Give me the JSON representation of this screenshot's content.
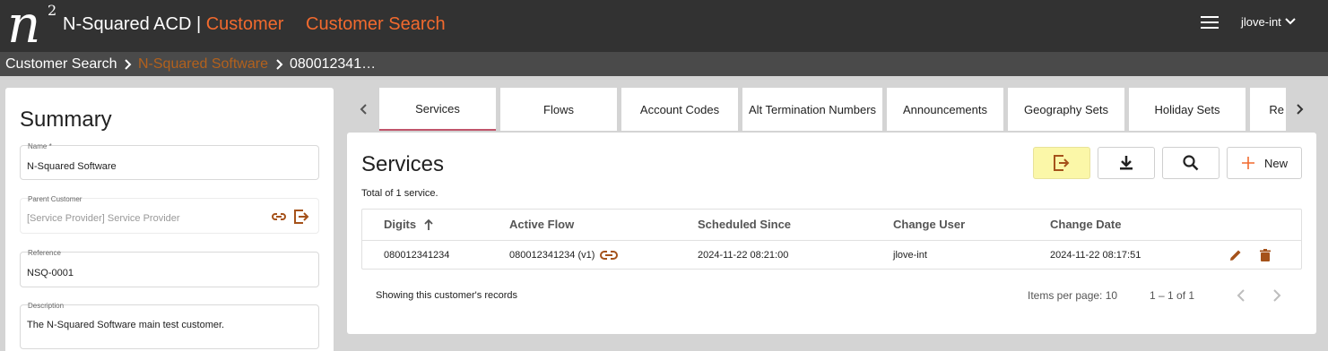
{
  "header": {
    "logo_letter": "n",
    "logo_sup": "2",
    "app_name": "N-Squared ACD",
    "separator": "|",
    "section": "Customer",
    "nav_link": "Customer Search",
    "user": "jlove-int"
  },
  "breadcrumb": [
    "Customer Search",
    "N-Squared Software",
    "080012341…"
  ],
  "summary": {
    "title": "Summary",
    "fields": {
      "name": {
        "label": "Name *",
        "value": "N-Squared Software"
      },
      "parent": {
        "label": "Parent Customer",
        "value": "[Service Provider] Service Provider"
      },
      "reference": {
        "label": "Reference",
        "value": "NSQ-0001"
      },
      "description": {
        "label": "Description",
        "value": "The N-Squared Software main test customer."
      }
    }
  },
  "tabs": [
    "Services",
    "Flows",
    "Account Codes",
    "Alt Termination Numbers",
    "Announcements",
    "Geography Sets",
    "Holiday Sets",
    "Re"
  ],
  "services": {
    "title": "Services",
    "total": "Total of 1 service.",
    "new_label": "New",
    "columns": [
      "Digits",
      "Active Flow",
      "Scheduled Since",
      "Change User",
      "Change Date"
    ],
    "rows": [
      {
        "digits": "080012341234",
        "active_flow": "080012341234 (v1)",
        "scheduled_since": "2024-11-22 08:21:00",
        "change_user": "jlove-int",
        "change_date": "2024-11-22 08:17:51"
      }
    ],
    "footer": {
      "note": "Showing this customer's records",
      "items_per_page": "Items per page: 10",
      "range": "1 – 1 of 1"
    }
  },
  "colors": {
    "accent": "#f26a2e",
    "icon_brown": "#a5521a",
    "topbar": "#323232",
    "highlight": "#fbf7a8"
  }
}
